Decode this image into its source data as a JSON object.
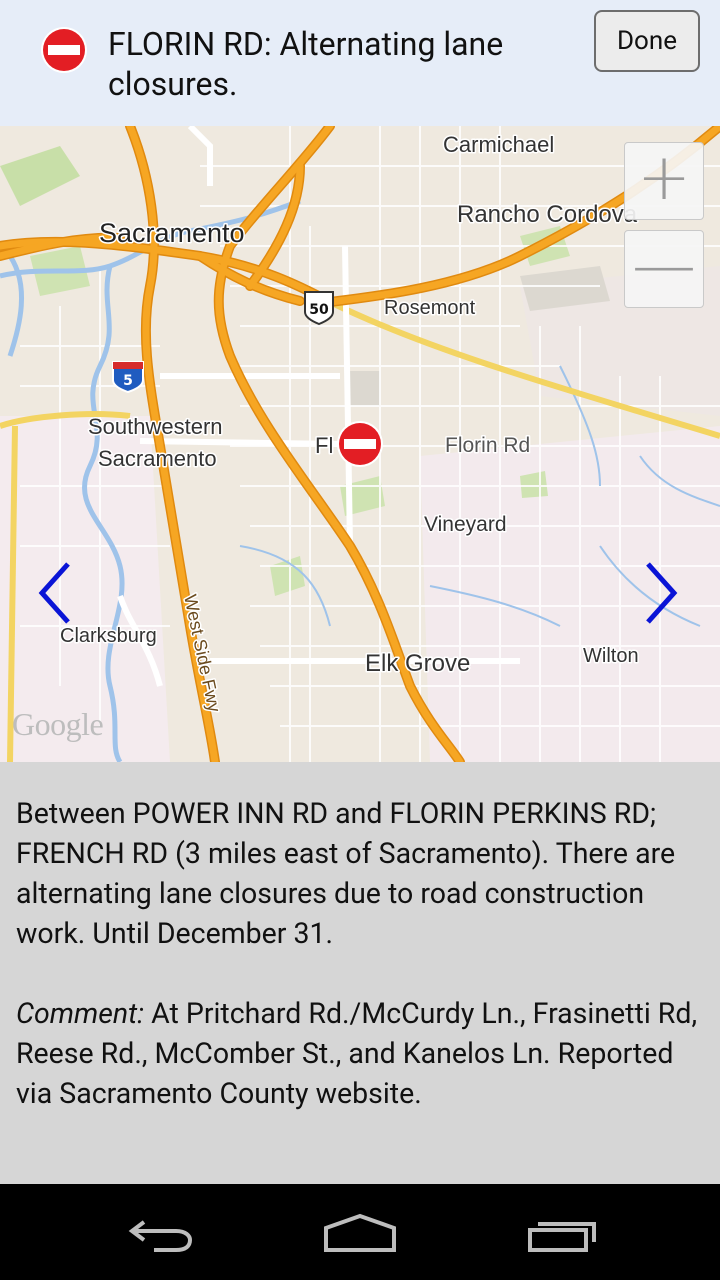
{
  "header": {
    "alert_icon": "no-entry-icon",
    "title": "FLORIN RD: Alternating lane closures.",
    "done_label": "Done"
  },
  "map": {
    "labels": {
      "carmichael": "Carmichael",
      "rancho_cordova": "Rancho Cordova",
      "sacramento": "Sacramento",
      "rosemont": "Rosemont",
      "southwestern_1": "Southwestern",
      "southwestern_2": "Sacramento",
      "florin_partial": "Fl",
      "florin_rd": "Florin Rd",
      "vineyard": "Vineyard",
      "clarksburg": "Clarksburg",
      "elk_grove": "Elk Grove",
      "wilton": "Wilton",
      "west_side_fwy": "West Side Fwy",
      "shield_50": "50",
      "shield_5": "5"
    },
    "zoom_in_label": "+",
    "zoom_out_label": "—",
    "attribution": "Google",
    "marker_icon": "no-entry-icon",
    "prev_icon": "chevron-left-icon",
    "next_icon": "chevron-right-icon",
    "colors": {
      "land": "#efe9df",
      "highway": "#f6a623",
      "highway_outline": "#e08a10",
      "arterial": "#f3d462",
      "water": "#9fc3ea",
      "park": "#c8dfa8",
      "marker": "#e31e24",
      "arrow": "#0a14d6"
    }
  },
  "details": {
    "description": "Between POWER INN RD and FLORIN PERKINS RD; FRENCH RD (3 miles east of Sacramento). There are alternating lane closures due to road construction work. Until December 31.",
    "comment_label": "Comment:",
    "comment_text": " At Pritchard Rd./McCurdy Ln., Frasinetti Rd, Reese Rd., McComber St., and Kanelos Ln. Reported via Sacramento County website."
  },
  "system_nav": {
    "back_icon": "back-icon",
    "home_icon": "home-icon",
    "recents_icon": "recents-icon"
  }
}
